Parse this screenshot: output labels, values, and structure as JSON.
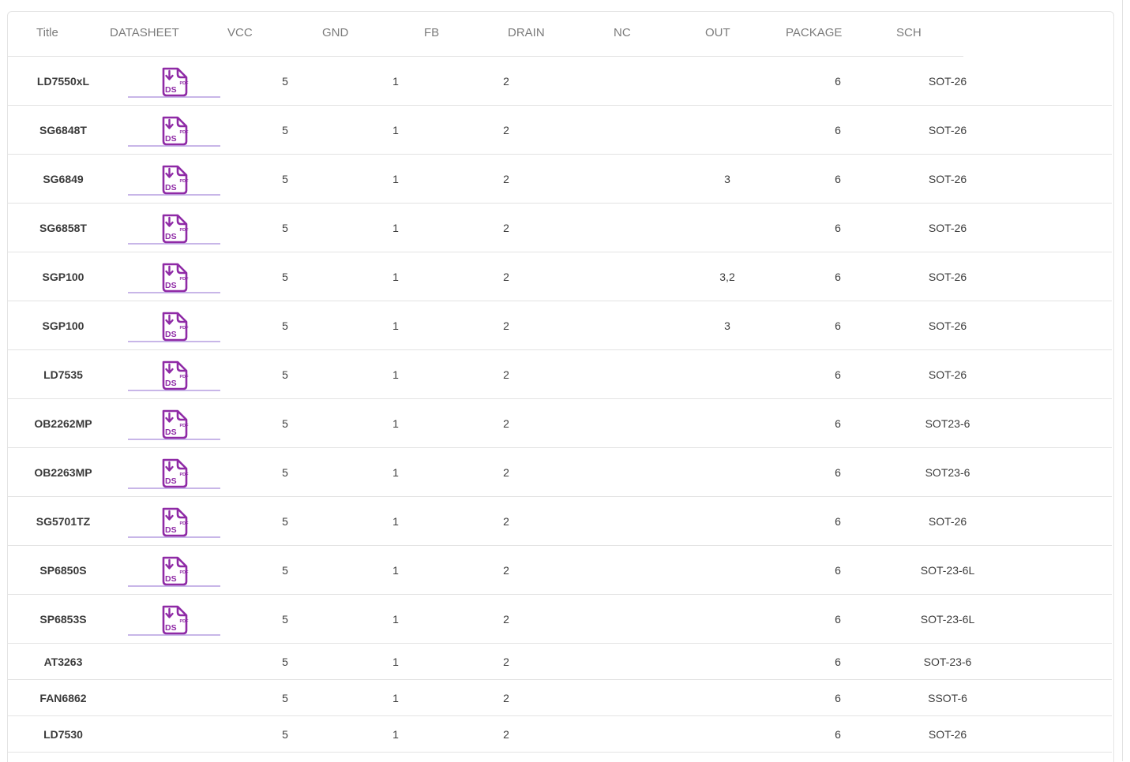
{
  "columns": [
    "Title",
    "DATASHEET",
    "VCC",
    "GND",
    "FB",
    "DRAIN",
    "NC",
    "OUT",
    "PACKAGE",
    "SCH"
  ],
  "datasheet_icon": {
    "text": "DS",
    "badge": "PDF",
    "color": "#8f2aa6"
  },
  "rows": [
    {
      "title": "LD7550xL",
      "ds": true,
      "vcc": "5",
      "gnd": "1",
      "fb": "2",
      "nc": "",
      "out": "6",
      "package": "SOT-26"
    },
    {
      "title": "SG6848T",
      "ds": true,
      "vcc": "5",
      "gnd": "1",
      "fb": "2",
      "nc": "",
      "out": "6",
      "package": "SOT-26"
    },
    {
      "title": "SG6849",
      "ds": true,
      "vcc": "5",
      "gnd": "1",
      "fb": "2",
      "nc": "3",
      "out": "6",
      "package": "SOT-26"
    },
    {
      "title": "SG6858T",
      "ds": true,
      "vcc": "5",
      "gnd": "1",
      "fb": "2",
      "nc": "",
      "out": "6",
      "package": "SOT-26"
    },
    {
      "title": "SGP100",
      "ds": true,
      "vcc": "5",
      "gnd": "1",
      "fb": "2",
      "nc": "3,2",
      "out": "6",
      "package": "SOT-26"
    },
    {
      "title": "SGP100",
      "ds": true,
      "vcc": "5",
      "gnd": "1",
      "fb": "2",
      "nc": "3",
      "out": "6",
      "package": "SOT-26"
    },
    {
      "title": "LD7535",
      "ds": true,
      "vcc": "5",
      "gnd": "1",
      "fb": "2",
      "nc": "",
      "out": "6",
      "package": "SOT-26"
    },
    {
      "title": "OB2262MP",
      "ds": true,
      "vcc": "5",
      "gnd": "1",
      "fb": "2",
      "nc": "",
      "out": "6",
      "package": "SOT23-6"
    },
    {
      "title": "OB2263MP",
      "ds": true,
      "vcc": "5",
      "gnd": "1",
      "fb": "2",
      "nc": "",
      "out": "6",
      "package": "SOT23-6"
    },
    {
      "title": "SG5701TZ",
      "ds": true,
      "vcc": "5",
      "gnd": "1",
      "fb": "2",
      "nc": "",
      "out": "6",
      "package": "SOT-26"
    },
    {
      "title": "SP6850S",
      "ds": true,
      "vcc": "5",
      "gnd": "1",
      "fb": "2",
      "nc": "",
      "out": "6",
      "package": "SOT-23-6L"
    },
    {
      "title": "SP6853S",
      "ds": true,
      "vcc": "5",
      "gnd": "1",
      "fb": "2",
      "nc": "",
      "out": "6",
      "package": "SOT-23-6L"
    },
    {
      "title": "AT3263",
      "ds": false,
      "vcc": "5",
      "gnd": "1",
      "fb": "2",
      "nc": "",
      "out": "6",
      "package": "SOT-23-6"
    },
    {
      "title": "FAN6862",
      "ds": false,
      "vcc": "5",
      "gnd": "1",
      "fb": "2",
      "nc": "",
      "out": "6",
      "package": "SSOT-6"
    },
    {
      "title": "LD7530",
      "ds": false,
      "vcc": "5",
      "gnd": "1",
      "fb": "2",
      "nc": "",
      "out": "6",
      "package": "SOT-26"
    }
  ]
}
